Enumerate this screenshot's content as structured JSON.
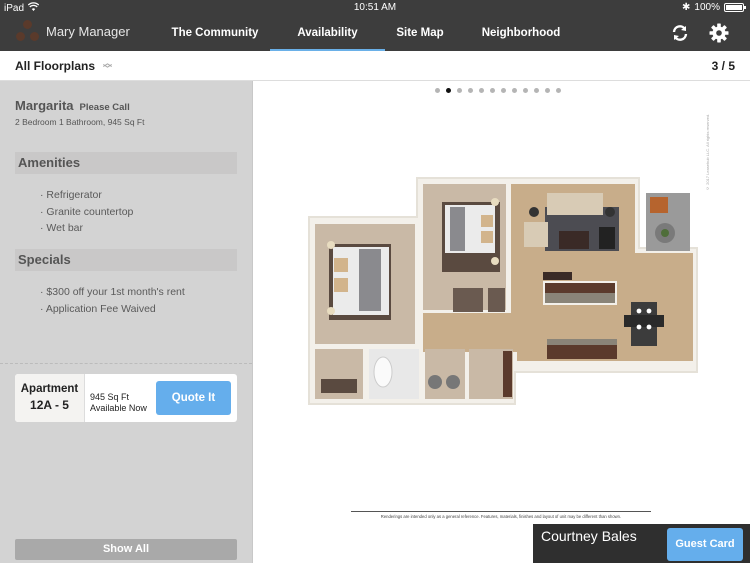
{
  "status_bar": {
    "device": "iPad",
    "time": "10:51 AM",
    "battery": "100%",
    "battery_level": 1.0
  },
  "nav": {
    "user_name": "Mary Manager",
    "tabs": [
      {
        "label": "The Community",
        "active": false
      },
      {
        "label": "Availability",
        "active": true
      },
      {
        "label": "Site Map",
        "active": false
      },
      {
        "label": "Neighborhood",
        "active": false
      }
    ],
    "icons": [
      "refresh-icon",
      "gear-icon"
    ],
    "accent_color": "#6ab0e8"
  },
  "subbar": {
    "filter_label": "All Floorplans",
    "pager": "3 / 5"
  },
  "floorplan": {
    "name": "Margarita",
    "availability_note": "Please Call",
    "description": "2 Bedroom 1 Bathroom, 945 Sq Ft",
    "amenities_title": "Amenities",
    "amenities": [
      "Refrigerator",
      "Granite countertop",
      "Wet bar"
    ],
    "specials_title": "Specials",
    "specials": [
      "$300 off your 1st month's rent",
      "Application Fee Waived"
    ]
  },
  "apartment_card": {
    "label": "Apartment",
    "unit": "12A - 5",
    "size": "945 Sq Ft",
    "availability": "Available Now",
    "quote_button": "Quote It"
  },
  "show_all_button": "Show All",
  "carousel": {
    "total_dots": 12,
    "active_index": 1
  },
  "rendering": {
    "copyright": "© 2017 Leasehub LLC. All rights reserved.",
    "disclaimer": "Renderings are intended only as a general reference. Features, materials, finishes and layout of unit may be different than shown."
  },
  "guest": {
    "name": "Courtney Bales",
    "button": "Guest Card",
    "button_color": "#65aeec"
  }
}
